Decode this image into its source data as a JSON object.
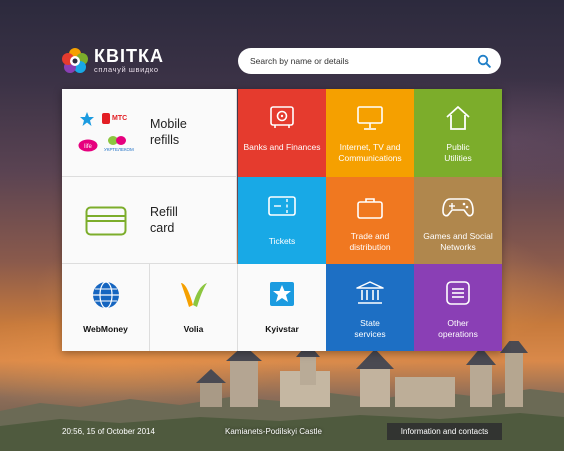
{
  "brand": {
    "name": "КВІТКА",
    "tagline": "сплачуй швидко"
  },
  "search": {
    "placeholder": "Search by name or details"
  },
  "tiles": {
    "mobile_refills": {
      "label_line1": "Mobile",
      "label_line2": "refills",
      "operators": [
        "Kyivstar",
        "МТС",
        "life:)",
        "Утел"
      ],
      "operator_mts": "МТС",
      "operator_utel": "УКРТЕЛЕКОМ"
    },
    "refill_card": {
      "label_line1": "Refill",
      "label_line2": "card"
    },
    "banks": {
      "label": "Banks and Finances",
      "color": "#e53b2e",
      "icon": "safe-icon"
    },
    "internet_tv": {
      "label": "Internet, TV and Communications",
      "color": "#f5a000",
      "icon": "monitor-icon"
    },
    "public_utilities": {
      "label": "Public Utilities",
      "color": "#7cad2b",
      "icon": "house-icon"
    },
    "tickets": {
      "label": "Tickets",
      "color": "#18a9e6",
      "icon": "ticket-icon"
    },
    "trade": {
      "label": "Trade and distribution",
      "color": "#f07820",
      "icon": "briefcase-icon"
    },
    "games": {
      "label": "Games and Social Networks",
      "color": "#b0874d",
      "icon": "gamepad-icon"
    },
    "webmoney": {
      "label": "WebMoney"
    },
    "volia": {
      "label": "Volia"
    },
    "kyivstar": {
      "label": "Kyivstar"
    },
    "state_services": {
      "label": "State services",
      "color": "#1d6fc4",
      "icon": "government-icon"
    },
    "other_operations": {
      "label": "Other operations",
      "color": "#8a3fb5",
      "icon": "list-icon"
    }
  },
  "footer": {
    "datetime": "20:56, 15 of October 2014",
    "location": "Kamianets-Podilskyi Castle",
    "info_button": "Information and contacts"
  }
}
